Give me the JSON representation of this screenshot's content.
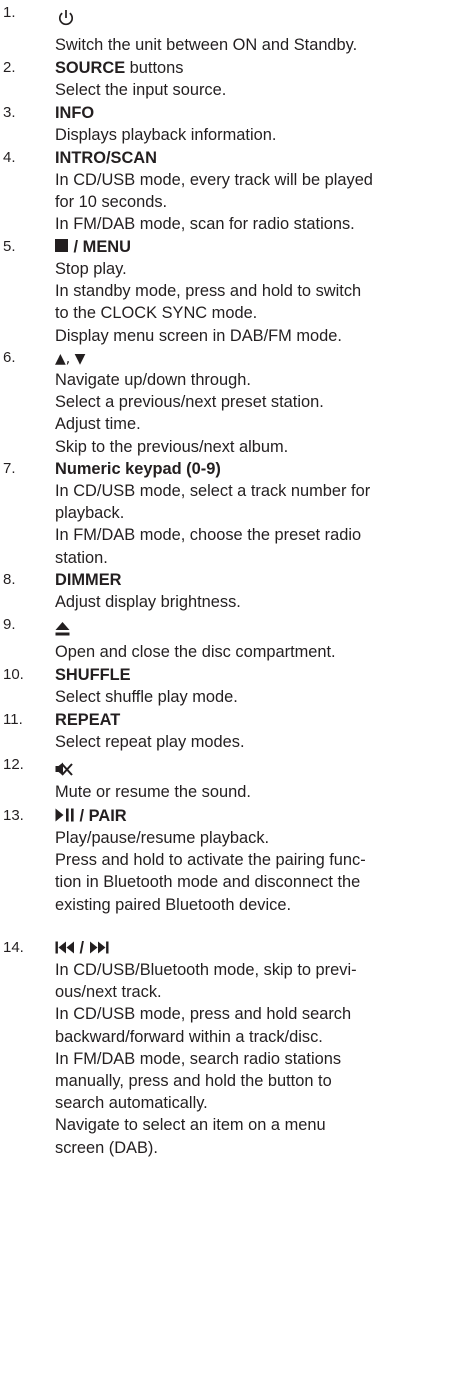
{
  "items": [
    {
      "num": "1.",
      "title": "",
      "icon": "power-icon",
      "desc": [
        "Switch the unit between ON and Standby."
      ]
    },
    {
      "num": "2.",
      "title": "SOURCE",
      "title_suffix": " buttons",
      "desc": [
        "Select the input source."
      ]
    },
    {
      "num": "3.",
      "title": "INFO",
      "desc": [
        "Displays playback information."
      ]
    },
    {
      "num": "4.",
      "title": "INTRO/SCAN",
      "desc": [
        "In CD/USB mode, every track will be played",
        "for 10 seconds.",
        "In FM/DAB mode, scan for radio stations."
      ]
    },
    {
      "num": "5.",
      "title": " / MENU",
      "icon": "stop-icon",
      "desc": [
        "Stop play.",
        "In standby mode, press and hold to switch",
        "to the CLOCK SYNC mode.",
        "Display menu screen in DAB/FM mode."
      ]
    },
    {
      "num": "6.",
      "title": "▲, ▼",
      "icon": "up-down-arrows-icon",
      "desc": [
        "Navigate up/down through.",
        "Select a previous/next preset station.",
        "Adjust time.",
        "Skip to the previous/next album."
      ]
    },
    {
      "num": "7.",
      "title": "Numeric keypad (0-9)",
      "desc": [
        "In CD/USB mode, select a track number for",
        "playback.",
        "In FM/DAB mode, choose the preset radio",
        "station."
      ]
    },
    {
      "num": "8.",
      "title": "DIMMER",
      "desc": [
        "Adjust display brightness."
      ]
    },
    {
      "num": "9.",
      "title": "",
      "icon": "eject-icon",
      "desc": [
        "Open and close the disc compartment."
      ]
    },
    {
      "num": "10.",
      "title": "SHUFFLE",
      "desc": [
        "Select shuffle play mode."
      ]
    },
    {
      "num": "11.",
      "title": "REPEAT",
      "desc": [
        "Select repeat play modes."
      ]
    },
    {
      "num": "12.",
      "title": "",
      "icon": "mute-icon",
      "desc": [
        "Mute or resume the sound."
      ]
    },
    {
      "num": "13.",
      "title": " / PAIR",
      "icon": "play-pause-icon",
      "desc": [
        "Play/pause/resume playback.",
        "Press and hold to activate the pairing func-",
        "tion in Bluetooth mode and disconnect the",
        "existing paired Bluetooth device."
      ]
    },
    {
      "num": "14.",
      "title": " / ",
      "icon": "skip-prev-next-icon",
      "desc": [
        "In CD/USB/Bluetooth mode, skip to previ-",
        "ous/next track.",
        "In CD/USB mode, press and hold search",
        "backward/forward within a track/disc.",
        "In FM/DAB mode, search radio stations",
        "manually, press and hold the button to",
        "search automatically.",
        "Navigate to select an item on a menu",
        "screen (DAB)."
      ]
    }
  ]
}
